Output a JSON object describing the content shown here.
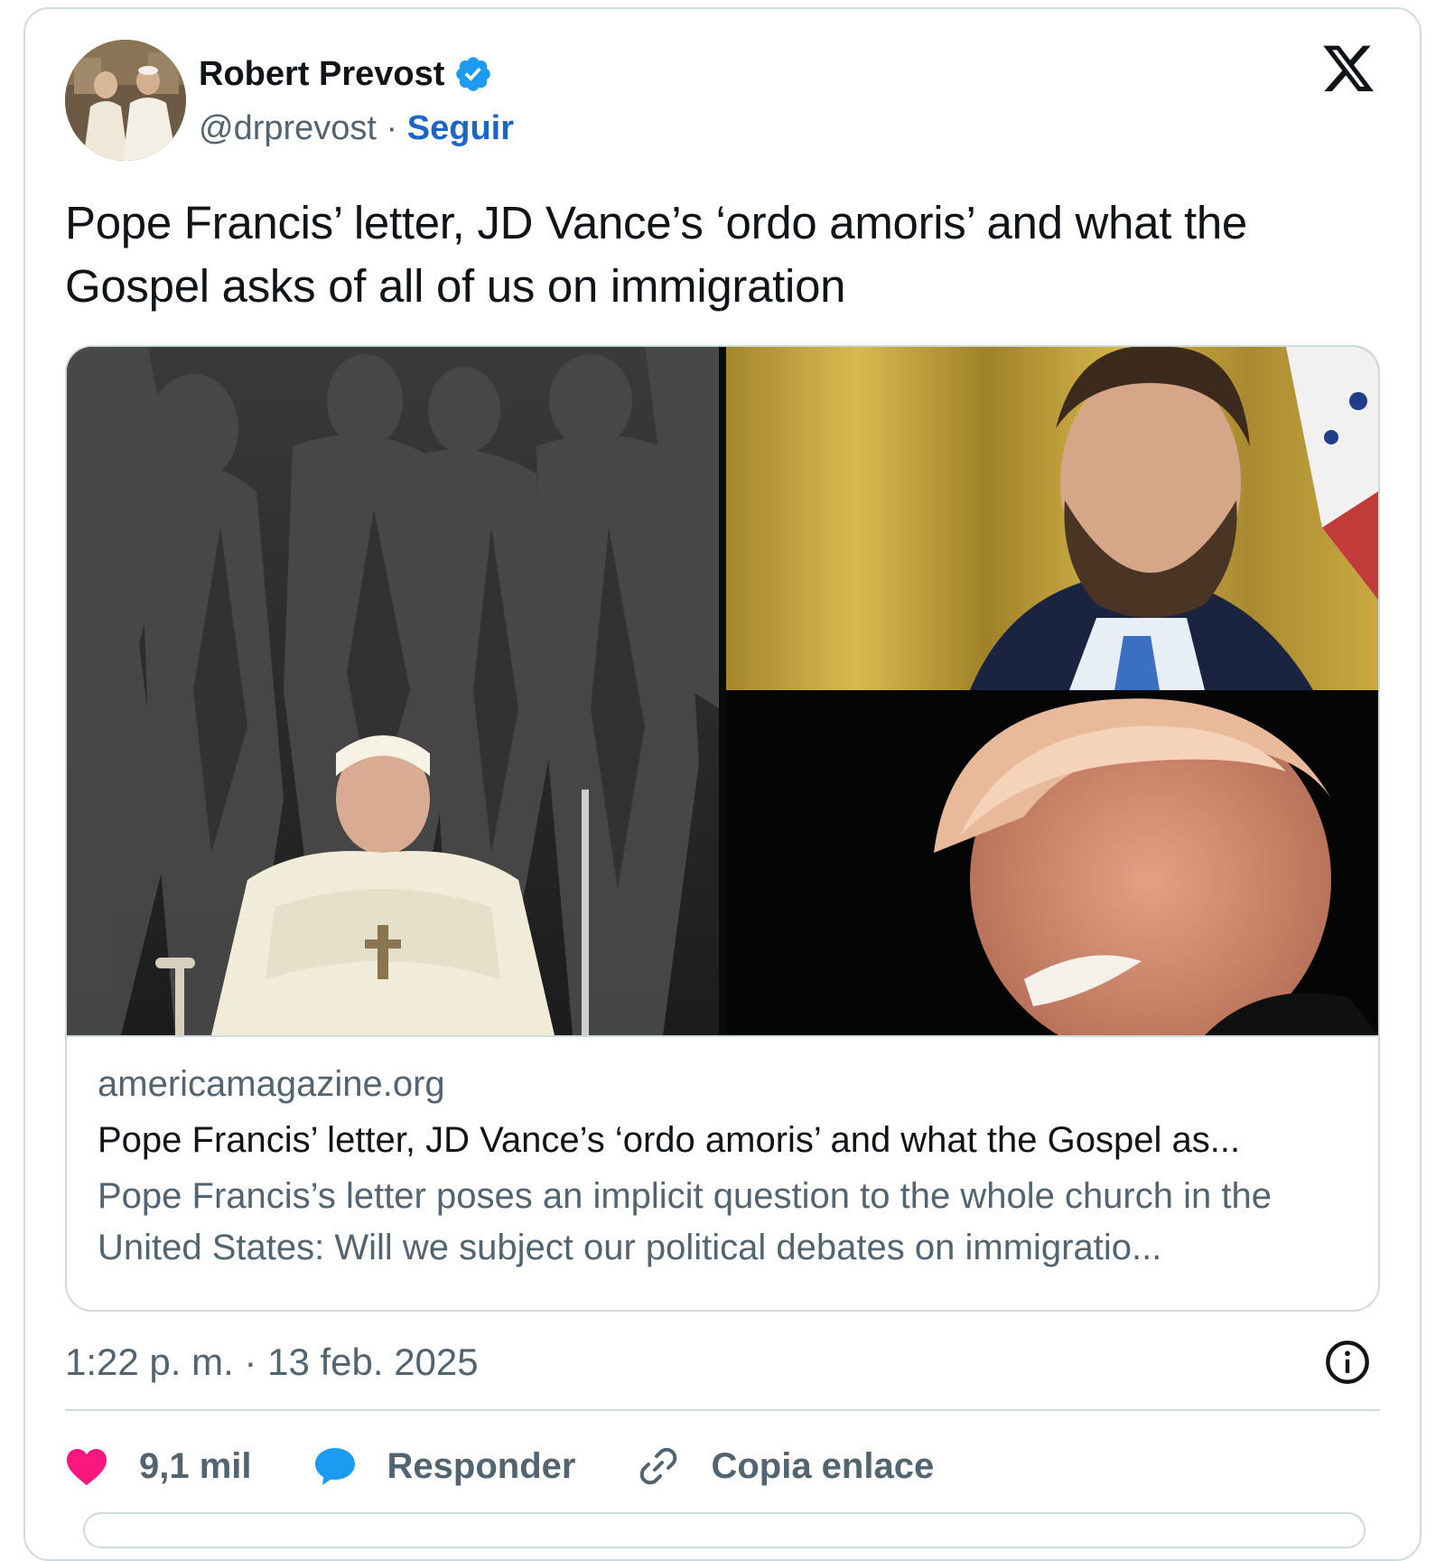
{
  "author": {
    "display_name": "Robert Prevost",
    "handle": "@drprevost",
    "separator": "·",
    "follow_label": "Seguir"
  },
  "icons": {
    "verified": "verified-badge-icon",
    "platform": "x-logo-icon",
    "info": "info-icon",
    "like": "heart-icon",
    "reply": "speech-bubble-icon",
    "copy_link": "link-icon"
  },
  "tweet": {
    "text": "Pope Francis’ letter, JD Vance’s ‘ordo amoris’ and what the Gospel asks of all of us on immigration"
  },
  "link_card": {
    "domain": "americamagazine.org",
    "title": "Pope Francis’ letter, JD Vance’s ‘ordo amoris’ and what the Gospel as...",
    "description": "Pope Francis’s letter poses an implicit question to the whole church in the United States: Will we subject our political debates on immigratio..."
  },
  "timestamp": "1:22 p. m. · 13 feb. 2025",
  "actions": {
    "likes": "9,1 mil",
    "reply": "Responder",
    "copy_link": "Copia enlace"
  },
  "colors": {
    "accent": "#1d66c8",
    "verified": "#1d9bf0",
    "like": "#f91880",
    "muted": "#536471",
    "border": "#cfd9de"
  }
}
